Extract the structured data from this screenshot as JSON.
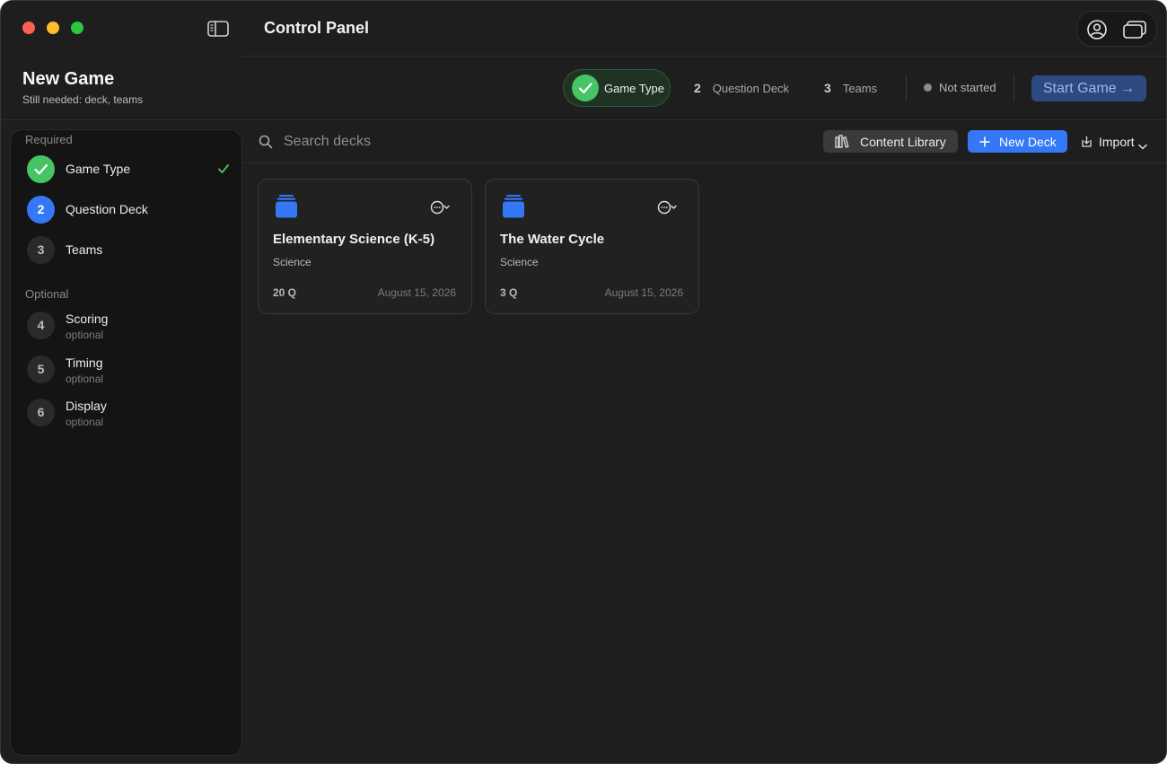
{
  "window": {
    "title": "Control Panel"
  },
  "game": {
    "title": "New Game",
    "subtitle": "Still needed: deck, teams"
  },
  "stepper": {
    "current": {
      "label": "Game Type",
      "state": "complete"
    },
    "steps": [
      {
        "num": "2",
        "label": "Question Deck"
      },
      {
        "num": "3",
        "label": "Teams"
      }
    ],
    "status": "Not started",
    "start_label": "Start Game →"
  },
  "sidebar": {
    "required_label": "Required",
    "optional_label": "Optional",
    "required": [
      {
        "num": "",
        "label": "Game Type",
        "state": "done"
      },
      {
        "num": "2",
        "label": "Question Deck",
        "state": "active"
      },
      {
        "num": "3",
        "label": "Teams",
        "state": "todo"
      }
    ],
    "optional": [
      {
        "num": "4",
        "label": "Scoring",
        "sub": "optional"
      },
      {
        "num": "5",
        "label": "Timing",
        "sub": "optional"
      },
      {
        "num": "6",
        "label": "Display",
        "sub": "optional"
      }
    ]
  },
  "toolbar": {
    "search_placeholder": "Search decks",
    "library_label": "Content Library",
    "new_deck_label": "New Deck",
    "import_label": "Import"
  },
  "decks": [
    {
      "title": "Elementary Science (K-5)",
      "category": "Science",
      "count": "20 Q",
      "date": "August 15, 2026"
    },
    {
      "title": "The Water Cycle",
      "category": "Science",
      "count": "3 Q",
      "date": "August 15, 2026"
    }
  ],
  "colors": {
    "accent": "#3478f6",
    "success": "#47c463",
    "background": "#1e1e1e",
    "sidebar": "#141414"
  }
}
